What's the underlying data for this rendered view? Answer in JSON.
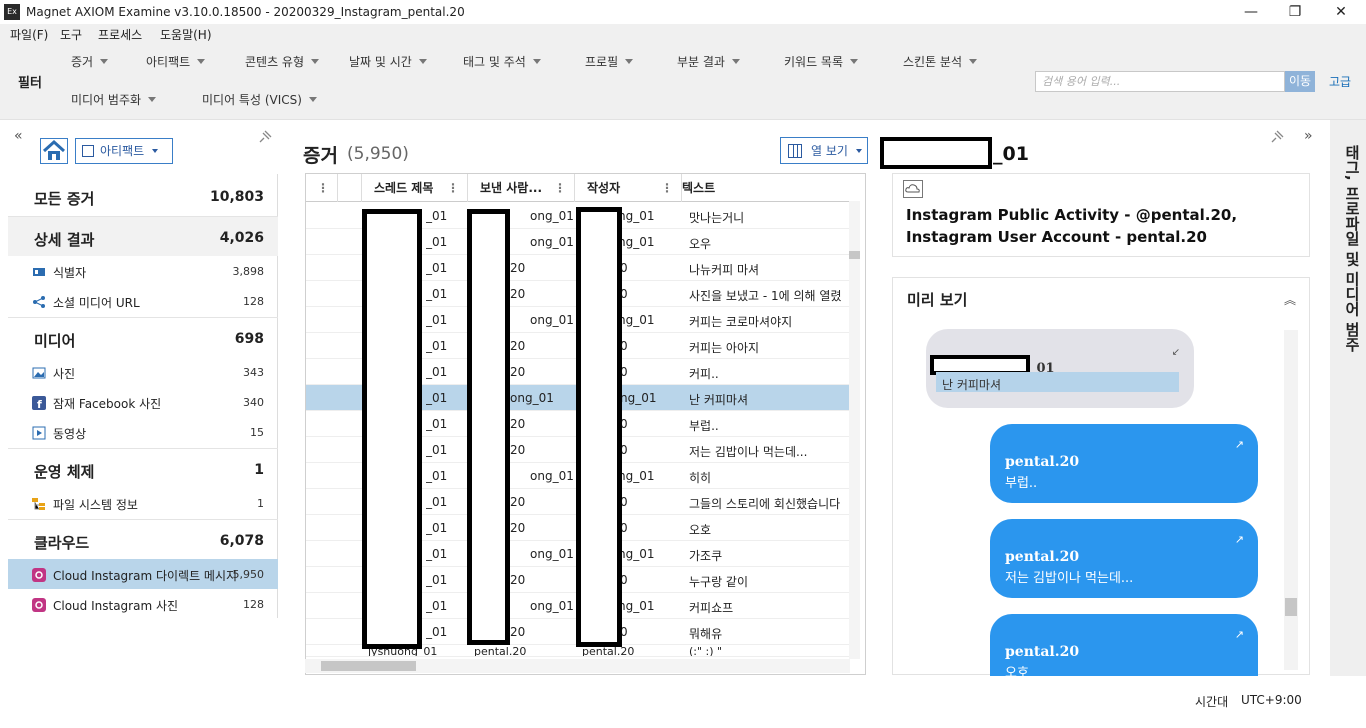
{
  "window": {
    "title": "Magnet AXIOM Examine v3.10.0.18500 - 20200329_Instagram_pental.20",
    "app_icon_text": "Ex",
    "minimize": "—",
    "restore": "❐",
    "close": "✕"
  },
  "menu": [
    "파일(F)",
    "도구",
    "프로세스",
    "도움말(H)"
  ],
  "toolbar": {
    "filter_label": "필터",
    "row1": [
      "증거",
      "아티팩트",
      "콘텐츠 유형",
      "날짜 및 시간",
      "태그 및 주석",
      "프로필",
      "부분 결과",
      "키워드 목록",
      "스킨톤 분석"
    ],
    "row2": [
      "미디어 범주화",
      "미디어 특성 (VICS)"
    ],
    "search_placeholder": "검색 용어 입력...",
    "search_go": "이동",
    "advanced": "고급"
  },
  "left_panel": {
    "collapse": "«",
    "artifact_dropdown": "아티팩트",
    "categories": [
      {
        "name": "모든 증거",
        "count": "10,803"
      },
      {
        "name": "상세 결과",
        "count": "4,026",
        "items": [
          {
            "name": "식별자",
            "count": "3,898"
          },
          {
            "name": "소셜 미디어 URL",
            "count": "128"
          }
        ]
      },
      {
        "name": "미디어",
        "count": "698",
        "items": [
          {
            "name": "사진",
            "count": "343"
          },
          {
            "name": "잠재 Facebook 사진",
            "count": "340"
          },
          {
            "name": "동영상",
            "count": "15"
          }
        ]
      },
      {
        "name": "운영 체제",
        "count": "1",
        "items": [
          {
            "name": "파일 시스템 정보",
            "count": "1"
          }
        ]
      },
      {
        "name": "클라우드",
        "count": "6,078",
        "items": [
          {
            "name": "Cloud Instagram 다이렉트 메시지",
            "count": "5,950"
          },
          {
            "name": "Cloud Instagram 사진",
            "count": "128"
          }
        ]
      }
    ]
  },
  "center": {
    "title": "증거",
    "count": "(5,950)",
    "column_view": "열 보기",
    "columns": [
      "스레드 제목",
      "보낸 사람...",
      "작성자",
      "텍스트"
    ],
    "rows": [
      {
        "c1": "_01",
        "c2": "ong_01",
        "c3": "ng_01",
        "text": "맛나는거니"
      },
      {
        "c1": "_01",
        "c2": "ong_01",
        "c3": "ng_01",
        "text": "오우"
      },
      {
        "c1": "_01",
        "c2": "20",
        "c3": "0",
        "text": "나뉴커피 마셔"
      },
      {
        "c1": "_01",
        "c2": "20",
        "c3": "0",
        "text": "사진을 보냈고 - 1에 의해 열렸"
      },
      {
        "c1": "_01",
        "c2": "ong_01",
        "c3": "ng_01",
        "text": "커피는 코로마셔야지"
      },
      {
        "c1": "_01",
        "c2": "20",
        "c3": "0",
        "text": "커피는 아아지"
      },
      {
        "c1": "_01",
        "c2": "20",
        "c3": "0",
        "text": "커피.."
      },
      {
        "c1": "_01",
        "c2": "ong_01",
        "c3": "ng_01",
        "text": "난 커피마셔"
      },
      {
        "c1": "_01",
        "c2": "20",
        "c3": "0",
        "text": "부럽.."
      },
      {
        "c1": "_01",
        "c2": "20",
        "c3": "0",
        "text": "저는 김밥이나 먹는데..."
      },
      {
        "c1": "_01",
        "c2": "ong_01",
        "c3": "ng_01",
        "text": "히히"
      },
      {
        "c1": "_01",
        "c2": "20",
        "c3": "0",
        "text": "그들의 스토리에 회신했습니다"
      },
      {
        "c1": "_01",
        "c2": "20",
        "c3": "0",
        "text": "오호"
      },
      {
        "c1": "_01",
        "c2": "ong_01",
        "c3": "ng_01",
        "text": "가조쿠"
      },
      {
        "c1": "_01",
        "c2": "20",
        "c3": "0",
        "text": "누구랑 같이"
      },
      {
        "c1": "_01",
        "c2": "ong_01",
        "c3": "ng_01",
        "text": "커피쇼프"
      },
      {
        "c1": "_01",
        "c2": "20",
        "c3": "0",
        "text": "뭐해유"
      },
      {
        "c1": "jyshuong_01",
        "c2": "pental.20",
        "c3": "pental.20",
        "text": "(:\" :) \" "
      }
    ]
  },
  "right": {
    "title_suffix": "_01",
    "card_text": "Instagram Public Activity - @pental.20, Instagram User Account - pental.20",
    "preview_title": "미리 보기",
    "incoming": {
      "sender_suffix": "_01",
      "message": "난 커피마셔"
    },
    "outgoing": [
      {
        "sender": "pental.20",
        "message": "부럽.."
      },
      {
        "sender": "pental.20",
        "message": "저는 김밥이나 먹는데..."
      },
      {
        "sender": "pental.20",
        "message": "오호"
      }
    ],
    "side_tab": "태그, 프로파일 및 미디어 범주"
  },
  "status": {
    "tz_label": "시간대",
    "tz_value": "UTC+9:00"
  }
}
